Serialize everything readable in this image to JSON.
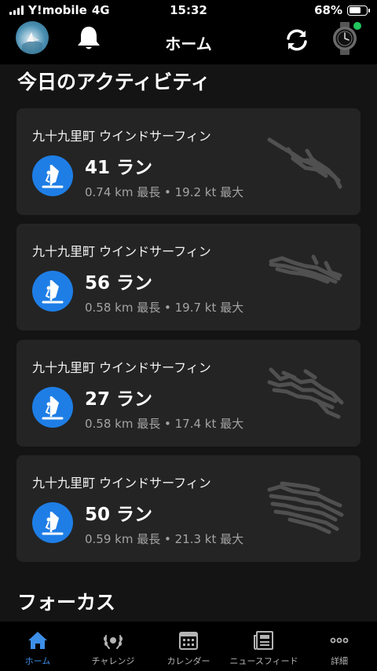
{
  "status": {
    "carrier": "Y!mobile",
    "network": "4G",
    "time": "15:32",
    "battery": "68%",
    "battery_level": 0.68
  },
  "nav": {
    "title": "ホーム"
  },
  "sections": {
    "today": "今日のアクティビティ",
    "focus": "フォーカス"
  },
  "activities": [
    {
      "title": "九十九里町 ウインドサーフィン",
      "runs": "41 ラン",
      "stats": "0.74 km 最長 • 19.2 kt 最大"
    },
    {
      "title": "九十九里町 ウインドサーフィン",
      "runs": "56 ラン",
      "stats": "0.58 km 最長 • 19.7 kt 最大"
    },
    {
      "title": "九十九里町 ウインドサーフィン",
      "runs": "27 ラン",
      "stats": "0.58 km 最長 • 17.4 kt 最大"
    },
    {
      "title": "九十九里町 ウインドサーフィン",
      "runs": "50 ラン",
      "stats": "0.59 km 最長 • 21.3 kt 最大"
    }
  ],
  "tabs": [
    {
      "label": "ホーム",
      "icon": "home-icon",
      "active": true
    },
    {
      "label": "チャレンジ",
      "icon": "laurel-icon",
      "active": false
    },
    {
      "label": "カレンダー",
      "icon": "calendar-icon",
      "active": false
    },
    {
      "label": "ニュースフィード",
      "icon": "newsfeed-icon",
      "active": false
    },
    {
      "label": "詳細",
      "icon": "more-icon",
      "active": false
    }
  ],
  "colors": {
    "accent": "#1e7ee6",
    "tab_active": "#3d8fe8",
    "card_bg": "#242424",
    "watch_status": "#22c55e"
  }
}
